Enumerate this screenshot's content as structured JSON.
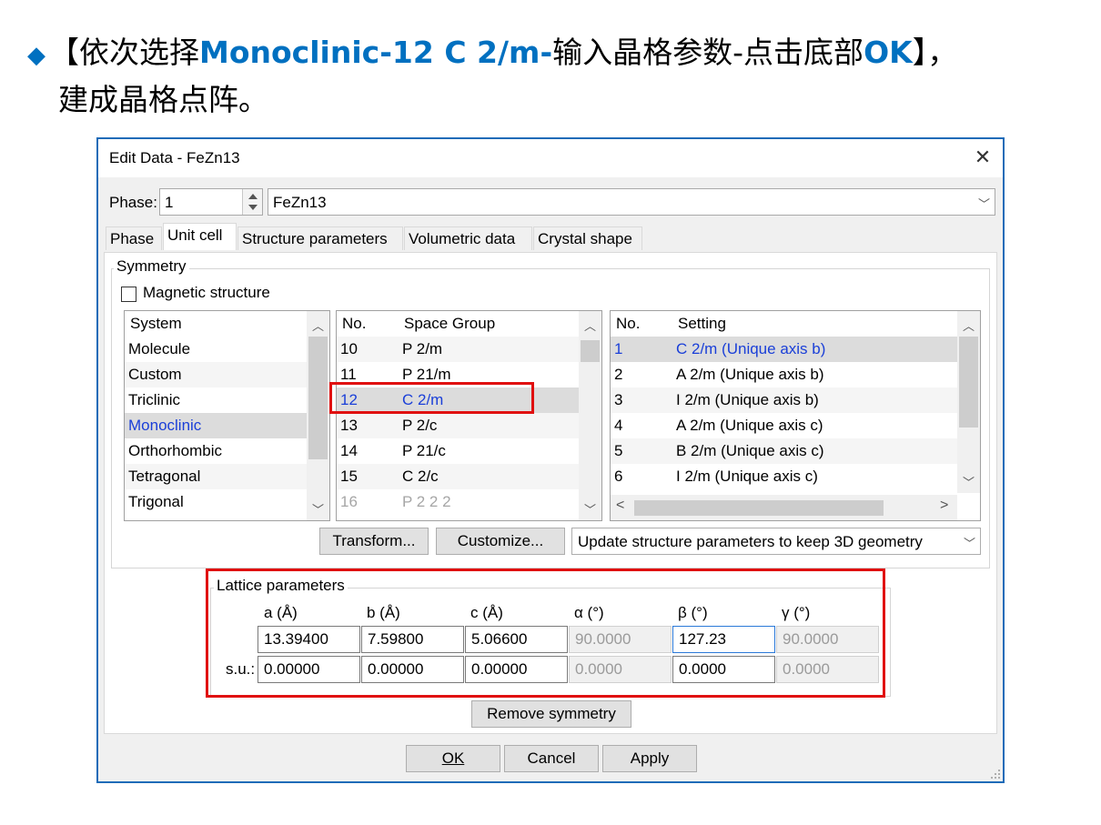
{
  "slide": {
    "line1_prefix": "◆",
    "line1_a": "【依次选择",
    "line1_b": "Monoclinic-12 C 2/m-",
    "line1_c": "输入晶格参数-点击底部",
    "line1_d": "OK",
    "line1_e": "】，",
    "line2": "建成晶格点阵。",
    "accent_color": "#0070c0"
  },
  "dialog": {
    "title": "Edit Data - FeZn13",
    "close_icon": "close-icon",
    "phase_label": "Phase:",
    "phase_number": "1",
    "phase_name": "FeZn13",
    "tabs": [
      "Phase",
      "Unit cell",
      "Structure parameters",
      "Volumetric data",
      "Crystal shape"
    ],
    "active_tab": "Unit cell",
    "symmetry": {
      "title": "Symmetry",
      "magnetic_label": "Magnetic structure",
      "magnetic_checked": false,
      "system_header": "System",
      "systems": [
        "Molecule",
        "Custom",
        "Triclinic",
        "Monoclinic",
        "Orthorhombic",
        "Tetragonal",
        "Trigonal"
      ],
      "selected_system": "Monoclinic",
      "sg_headers": [
        "No.",
        "Space Group"
      ],
      "space_groups": [
        {
          "no": "10",
          "name": "P 2/m"
        },
        {
          "no": "11",
          "name": "P 21/m"
        },
        {
          "no": "12",
          "name": "C 2/m"
        },
        {
          "no": "13",
          "name": "P 2/c"
        },
        {
          "no": "14",
          "name": "P 21/c"
        },
        {
          "no": "15",
          "name": "C 2/c"
        },
        {
          "no": "16",
          "name": "P 2 2 2"
        }
      ],
      "selected_space_group": "12",
      "setting_headers": [
        "No.",
        "Setting"
      ],
      "settings": [
        {
          "no": "1",
          "name": "C 2/m (Unique axis b)"
        },
        {
          "no": "2",
          "name": "A 2/m (Unique axis b)"
        },
        {
          "no": "3",
          "name": "I 2/m (Unique axis b)"
        },
        {
          "no": "4",
          "name": "A 2/m (Unique axis c)"
        },
        {
          "no": "5",
          "name": "B 2/m (Unique axis c)"
        },
        {
          "no": "6",
          "name": "I 2/m (Unique axis c)"
        }
      ],
      "selected_setting": "1",
      "transform_label": "Transform...",
      "customize_label": "Customize...",
      "update_option": "Update structure parameters to keep 3D geometry"
    },
    "lattice": {
      "title": "Lattice parameters",
      "headers": [
        "a (Å)",
        "b (Å)",
        "c (Å)",
        "α (°)",
        "β (°)",
        "γ (°)"
      ],
      "values": [
        "13.39400",
        "7.59800",
        "5.06600",
        "90.0000",
        "127.23",
        "90.0000"
      ],
      "su_label": "s.u.:",
      "su_values": [
        "0.00000",
        "0.00000",
        "0.00000",
        "0.0000",
        "0.0000",
        "0.0000"
      ]
    },
    "remove_symmetry_label": "Remove symmetry",
    "buttons": {
      "ok": "OK",
      "cancel": "Cancel",
      "apply": "Apply"
    }
  },
  "highlight_color": "#e01010"
}
